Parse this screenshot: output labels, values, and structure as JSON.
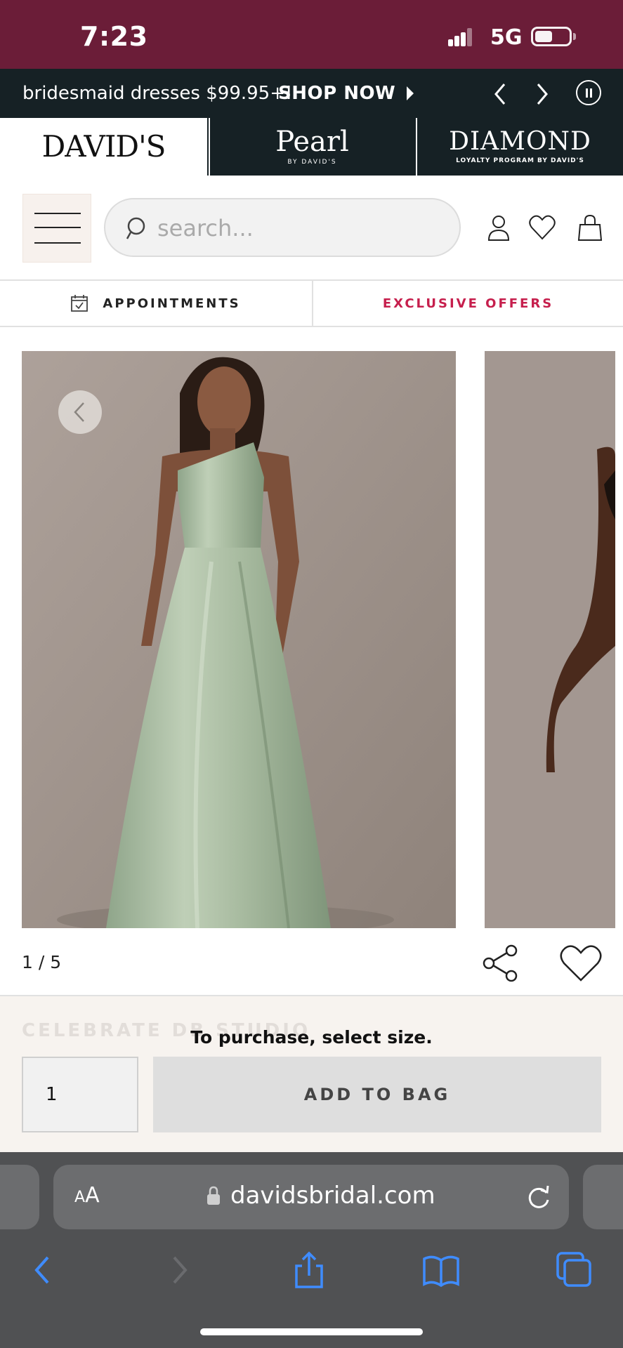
{
  "status_bar": {
    "time": "7:23",
    "network": "5G"
  },
  "promo": {
    "text": "bridesmaid dresses $99.95+!",
    "cta": "SHOP NOW"
  },
  "brand_tabs": {
    "davids": {
      "name": "DAVID'S"
    },
    "pearl": {
      "name": "Pearl",
      "sub": "BY DAVID'S"
    },
    "diamond": {
      "name": "DIAMOND",
      "sub": "LOYALTY PROGRAM BY DAVID'S"
    }
  },
  "header": {
    "search_placeholder": "search..."
  },
  "nav": {
    "appointments": "APPOINTMENTS",
    "offers": "EXCLUSIVE OFFERS"
  },
  "gallery": {
    "counter": "1 / 5"
  },
  "purchase": {
    "ghost_text": "CELEBRATE DB STUDIO",
    "hint": "To purchase, select size.",
    "quantity": "1",
    "add_to_bag": "ADD TO BAG"
  },
  "safari": {
    "aa_small": "A",
    "aa_big": "A",
    "url": "davidsbridal.com"
  },
  "colors": {
    "status_bar": "#6b1d38",
    "promo_bg": "#162125",
    "offers_accent": "#c61f4d",
    "safari_accent": "#3f8cff"
  },
  "icons": {
    "signal": "signal-icon",
    "battery": "battery-icon",
    "menu": "hamburger-menu-icon",
    "search": "search-icon",
    "account": "account-icon",
    "wishlist": "heart-icon",
    "bag": "shopping-bag-icon",
    "calendar": "calendar-icon",
    "share": "share-icon",
    "lock": "lock-icon",
    "reload": "reload-icon"
  }
}
